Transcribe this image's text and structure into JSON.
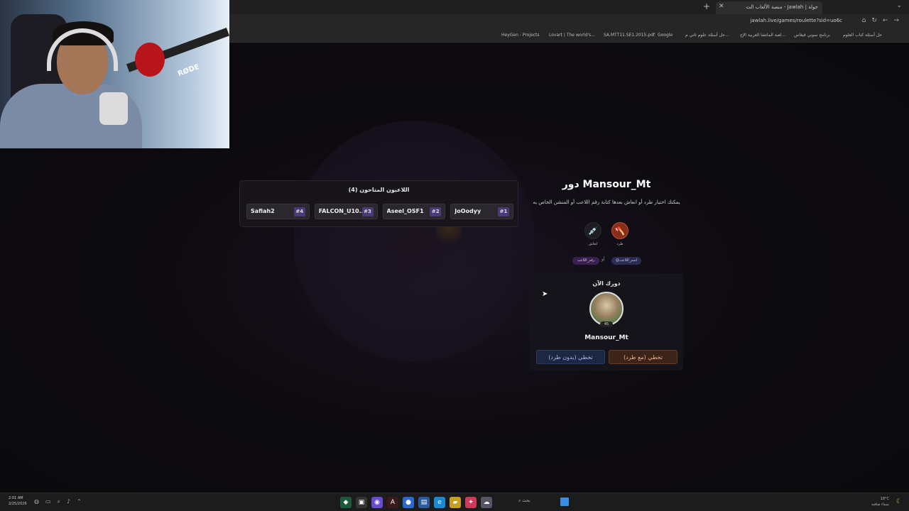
{
  "browser": {
    "tab_title": "جولة | Jawlah - منصة الألعاب الت",
    "url": "jawlah.live/games/roulette?sid=uo6c",
    "bookmarks": [
      "HeyGen - Projects",
      "Lovart | The world's...",
      "SA.MTT11.SE1.2015.pdf",
      "Google",
      "حل أسئلة علوم ثاني م...",
      "لعبة الماتشا العربية الإج...",
      "برنامج سوني فيغاس",
      "حل أسئلة كتاب العلوم"
    ]
  },
  "players_panel": {
    "title": "اللاعبون المتاحون (4)",
    "players": [
      {
        "name": "Safiah2",
        "rank": "#4"
      },
      {
        "name": "FALCON_U10...",
        "rank": "#3"
      },
      {
        "name": "Aseel_OSF1",
        "rank": "#2"
      },
      {
        "name": "JoOodyy",
        "rank": "#1"
      }
    ]
  },
  "turn": {
    "title": "دور Mansour_Mt",
    "description": "يمكنك اختيار طرد أو انعاش بعدها كتابة رقم اللاعب أو المنشن الخاص به",
    "actions": {
      "kick_label": "طرد",
      "revive_label": "انعاش"
    },
    "tag_a": "@اسم_اللاعب",
    "tag_or": "أو",
    "tag_b": "رقم_اللاعب"
  },
  "current_card": {
    "title": "دورك الآن",
    "player_name": "Mansour_Mt",
    "badge": "45",
    "skip_with_kick": "تخطي (مع طرد)",
    "skip_without_kick": "تخطي (بدون طرد)"
  },
  "taskbar": {
    "time": "2:01 AM",
    "date": "2/25/2026",
    "search_label": "بحث",
    "weather_temp": "18°C",
    "weather_text": "سماء صافية"
  },
  "webcam": {
    "mic_brand": "RØDE"
  }
}
